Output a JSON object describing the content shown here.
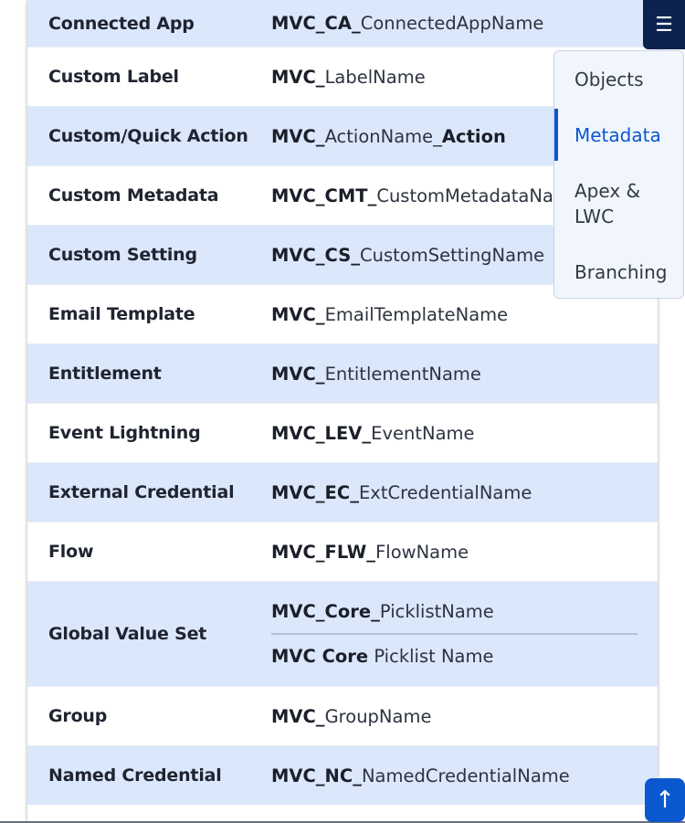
{
  "rows": [
    {
      "type": "Connected App",
      "bold": "MVC_CA_",
      "rest": "ConnectedAppName",
      "bold2": ""
    },
    {
      "type": "Custom Label",
      "bold": "MVC_",
      "rest": "LabelName",
      "bold2": ""
    },
    {
      "type": "Custom/Quick Action",
      "bold": "MVC_",
      "rest": "ActionName_",
      "bold2": "Action"
    },
    {
      "type": "Custom Metadata",
      "bold": "MVC_CMT_",
      "rest": "CustomMetadataNa",
      "bold2": ""
    },
    {
      "type": "Custom Setting",
      "bold": "MVC_CS_",
      "rest": "CustomSettingName",
      "bold2": ""
    },
    {
      "type": "Email Template",
      "bold": "MVC_",
      "rest": "EmailTemplateName",
      "bold2": ""
    },
    {
      "type": "Entitlement",
      "bold": "MVC_",
      "rest": "EntitlementName",
      "bold2": ""
    },
    {
      "type": "Event Lightning",
      "bold": "MVC_LEV_",
      "rest": "EventName",
      "bold2": ""
    },
    {
      "type": "External Credential",
      "bold": "MVC_EC_",
      "rest": "ExtCredentialName",
      "bold2": ""
    },
    {
      "type": "Flow",
      "bold": "MVC_FLW_",
      "rest": "FlowName",
      "bold2": ""
    },
    {
      "type": "Global Value Set",
      "api_bold": "MVC_Core_",
      "api_rest": "PicklistName",
      "label_bold": "MVC Core",
      "label_rest": " Picklist Name"
    },
    {
      "type": "Group",
      "bold": "MVC_",
      "rest": "GroupName",
      "bold2": ""
    },
    {
      "type": "Named Credential",
      "bold": "MVC_NC_",
      "rest": "NamedCredentialName",
      "bold2": ""
    }
  ],
  "toc": {
    "items": [
      "Objects",
      "Metadata",
      "Apex & LWC",
      "Branching"
    ],
    "active_index": 1,
    "active_color": "#0b57d0"
  },
  "menu_button": {
    "icon": "☰",
    "icon_name": "hamburger-menu-icon"
  },
  "back_to_top": {
    "icon": "↑",
    "icon_name": "arrow-up-icon"
  },
  "colors": {
    "row_alt": "#dbe7fb",
    "menu_bg": "#0c2350",
    "accent": "#0b57d0"
  }
}
